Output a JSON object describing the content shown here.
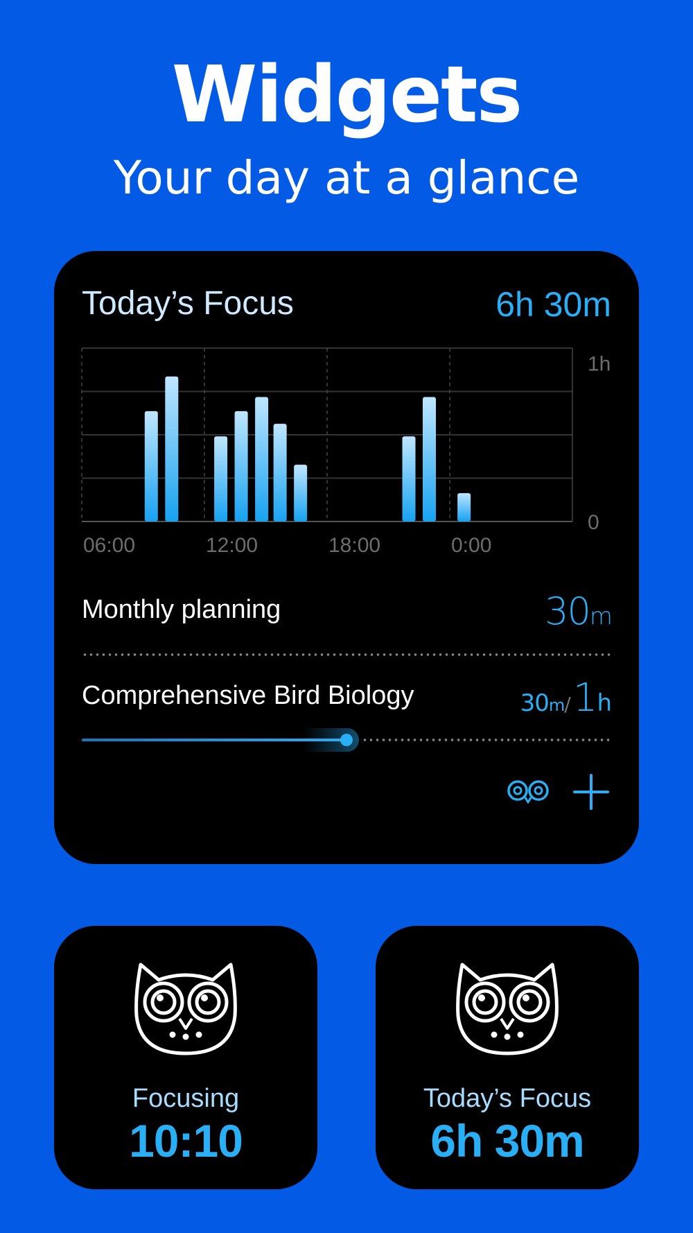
{
  "header": {
    "title": "Widgets",
    "subtitle": "Your day at a glance"
  },
  "focus_widget": {
    "title": "Today’s Focus",
    "total": "6h 30m",
    "chart_data": {
      "type": "bar",
      "x_ticks": [
        "06:00",
        "12:00",
        "18:00",
        "0:00"
      ],
      "y_ticks": [
        "1h",
        "0"
      ],
      "ylim": [
        0,
        1.1
      ],
      "grid": true,
      "values": [
        0.7,
        0.92,
        0.54,
        0.7,
        0.79,
        0.62,
        0.36,
        0.54,
        0.79,
        0.18
      ],
      "hour_offsets": [
        9.4,
        10.4,
        12.8,
        13.8,
        14.8,
        15.7,
        16.7,
        22.0,
        23.0,
        24.7
      ]
    },
    "tasks": [
      {
        "name": "Monthly planning",
        "time_value": "30",
        "time_unit": "m"
      },
      {
        "name": "Comprehensive Bird Biology",
        "done_value": "30",
        "done_unit": "m",
        "separator": "/",
        "goal_value": "1",
        "goal_unit": "h",
        "progress": 0.5
      }
    ],
    "actions": {
      "owl_icon": "owl-eyes-icon",
      "add_icon": "plus-icon"
    }
  },
  "small_widgets": [
    {
      "label": "Focusing",
      "value": "10:10",
      "icon": "owl-icon"
    },
    {
      "label": "Today’s Focus",
      "value": "6h 30m",
      "icon": "owl-icon"
    }
  ],
  "colors": {
    "background": "#035ae4",
    "widget": "#000000",
    "accent": "#2aaef5",
    "bar_top": "#bfe6ff",
    "bar_bottom": "#17a2f0"
  }
}
